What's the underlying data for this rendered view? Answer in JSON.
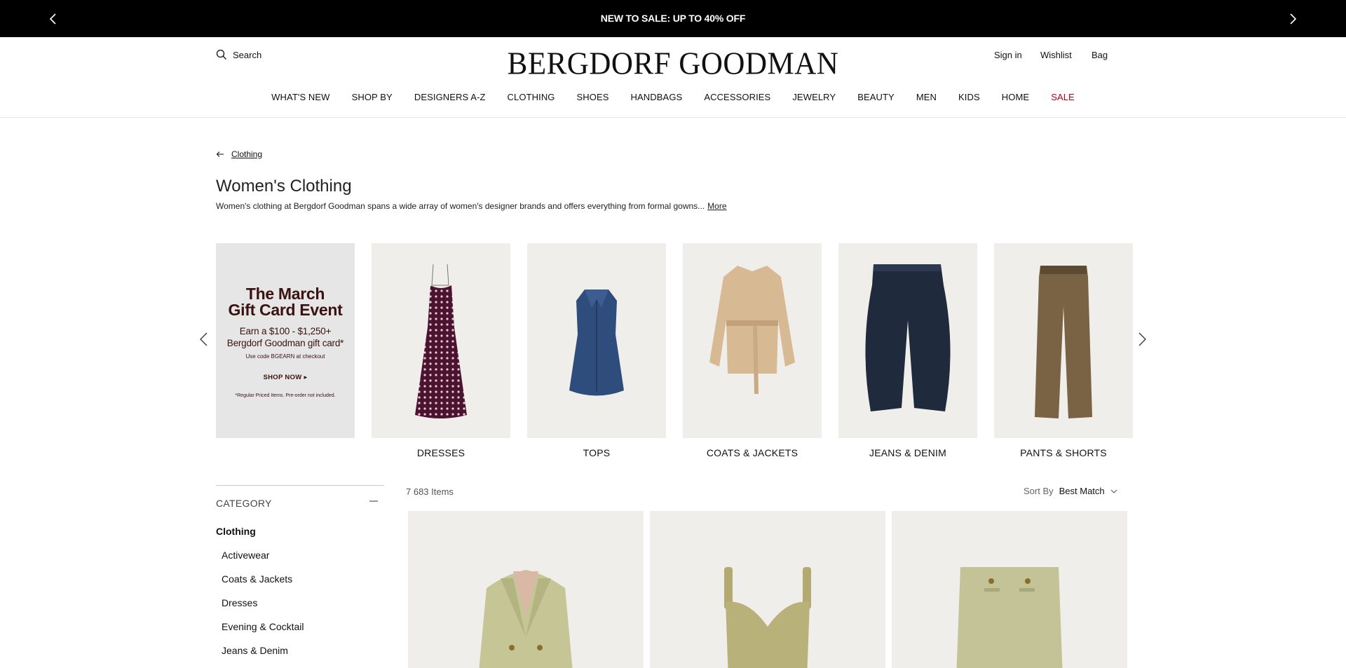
{
  "promo": {
    "text": "NEW TO SALE: UP TO 40% OFF"
  },
  "header": {
    "search_label": "Search",
    "logo": "BERGDORF GOODMAN",
    "sign_in": "Sign in",
    "wishlist": "Wishlist",
    "bag": "Bag"
  },
  "nav": [
    "WHAT'S NEW",
    "SHOP BY",
    "DESIGNERS A-Z",
    "CLOTHING",
    "SHOES",
    "HANDBAGS",
    "ACCESSORIES",
    "JEWELRY",
    "BEAUTY",
    "MEN",
    "KIDS",
    "HOME",
    "SALE"
  ],
  "breadcrumb": {
    "label": "Clothing"
  },
  "page": {
    "title": "Women's Clothing",
    "description": "Women's clothing at Bergdorf Goodman spans a wide array of women's designer brands and offers everything from formal gowns...",
    "more": "More"
  },
  "gift_tile": {
    "heading_1": "The March",
    "heading_2": "Gift Card Event",
    "sub_1": "Earn a $100 - $1,250+",
    "sub_2": "Bergdorf Goodman gift card*",
    "code": "Use code BGEARN at checkout",
    "cta": "SHOP NOW",
    "fine": "*Regular Priced Items. Pre-order not included."
  },
  "categories": [
    "DRESSES",
    "TOPS",
    "COATS & JACKETS",
    "JEANS & DENIM",
    "PANTS & SHORTS"
  ],
  "filters": {
    "heading": "CATEGORY",
    "selected": "Clothing",
    "items": [
      "Activewear",
      "Coats & Jackets",
      "Dresses",
      "Evening & Cocktail",
      "Jeans & Denim"
    ]
  },
  "results": {
    "count": "7 683 Items",
    "sort_label": "Sort By",
    "sort_value": "Best Match"
  },
  "colors": {
    "promo_bg": "#000000",
    "sale_red": "#b3001b",
    "tile_bg": "#efeeea",
    "gift_text": "#3a1211"
  }
}
